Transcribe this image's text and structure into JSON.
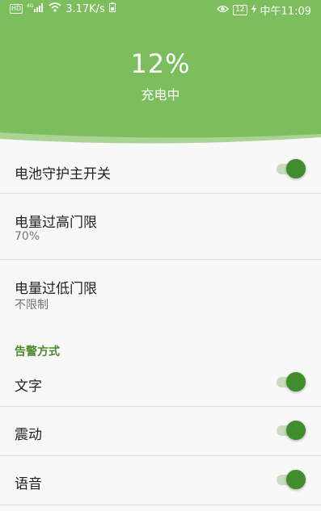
{
  "status_bar": {
    "hd": "HD",
    "net_type": "4G",
    "speed": "3.17K/s",
    "battery": "12",
    "time": "中午11:09"
  },
  "header": {
    "percent": "12%",
    "status": "充电中"
  },
  "settings": [
    {
      "title": "电池守护主开关",
      "type": "toggle",
      "on": true
    },
    {
      "title": "电量过高门限",
      "subtitle": "70%",
      "type": "value"
    },
    {
      "title": "电量过低门限",
      "subtitle": "不限制",
      "type": "value"
    }
  ],
  "alert_section": {
    "title": "告警方式",
    "items": [
      {
        "title": "文字",
        "on": true
      },
      {
        "title": "震动",
        "on": true
      },
      {
        "title": "语音",
        "on": true
      }
    ]
  },
  "colors": {
    "header_green": "#7cbe5e",
    "accent": "#3f8d2c",
    "section_text": "#4a8a2b"
  }
}
